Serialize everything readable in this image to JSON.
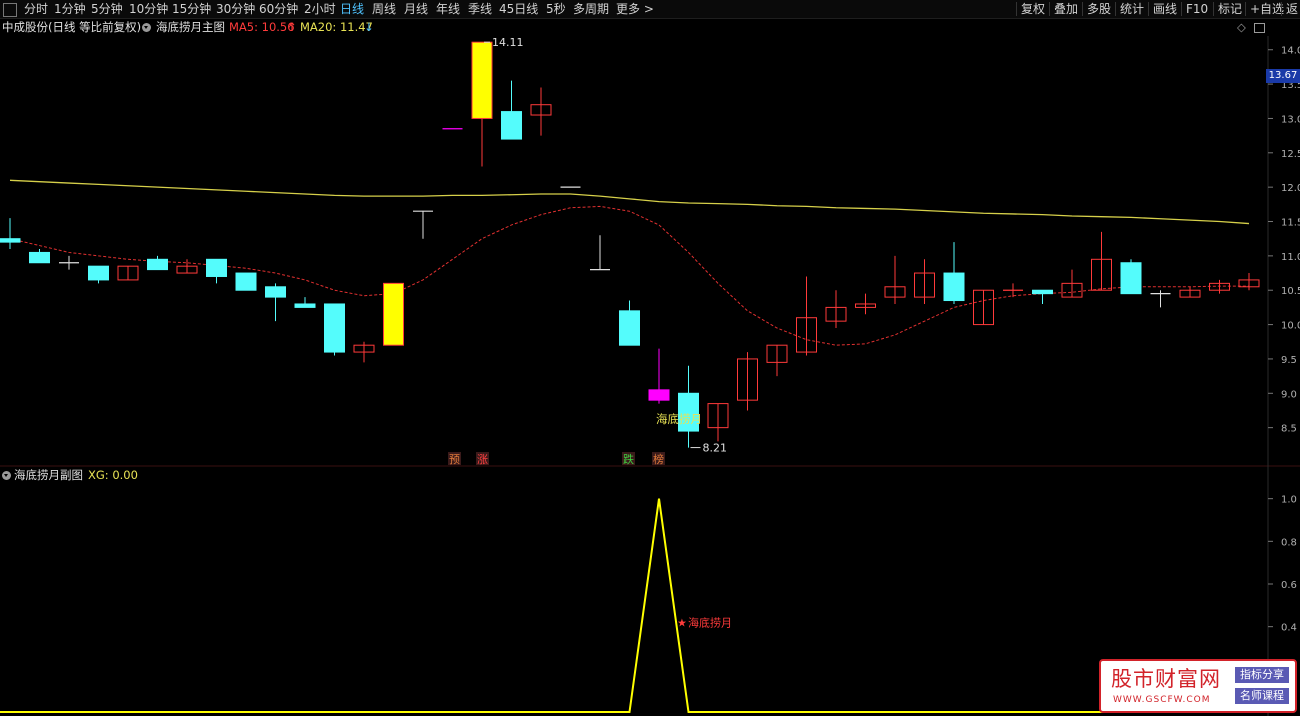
{
  "toolbar": {
    "periods": [
      "分时",
      "1分钟",
      "5分钟",
      "10分钟",
      "15分钟",
      "30分钟",
      "60分钟",
      "2小时",
      "日线",
      "周线",
      "月线",
      "年线",
      "季线",
      "45日线",
      "5秒",
      "多周期",
      "更多 >"
    ],
    "active_period": "日线",
    "right_buttons": [
      "复权",
      "叠加",
      "多股",
      "统计",
      "画线",
      "F10",
      "标记",
      "+自选",
      "返"
    ]
  },
  "main_chart": {
    "stock_title": "中成股份(日线 等比前复权)",
    "indicator_name": "海底捞月主图",
    "ma5_label": "MA5: 10.56",
    "ma5_arrow": "↑",
    "ma20_label": "MA20: 11.47",
    "ma20_arrow": "↓",
    "high_marker": "14.11",
    "low_marker": "8.21",
    "signal_text": "海底捞月",
    "signal_boxes": [
      "预",
      "涨",
      "跌",
      "榜"
    ],
    "current_price_tag": "13.67",
    "price_axis": [
      "14.0",
      "13.5",
      "13.0",
      "12.5",
      "12.0",
      "11.5",
      "11.0",
      "10.5",
      "10.0",
      "9.5",
      "9.0",
      "8.5"
    ],
    "colors": {
      "up": "#ff3a3a",
      "down": "#54fcfc",
      "ma5": "#e13030",
      "ma20": "#d6d04a",
      "yellow_signal": "#ffff00",
      "magenta": "#ff00ff"
    }
  },
  "sub_chart": {
    "indicator_name": "海底捞月副图",
    "xg_label": "XG: 0.00",
    "signal_label": "海底捞月",
    "axis": [
      "1.0",
      "0.8",
      "0.6",
      "0.4"
    ]
  },
  "chart_data": {
    "type": "candlestick",
    "title": "中成股份(日线 等比前复权)",
    "candles": [
      {
        "o": 11.25,
        "c": 11.2,
        "h": 11.55,
        "l": 11.1,
        "color": "down"
      },
      {
        "o": 11.05,
        "c": 10.9,
        "h": 11.1,
        "l": 10.9,
        "color": "down"
      },
      {
        "o": 10.9,
        "c": 10.9,
        "h": 11.0,
        "l": 10.8,
        "color": "flat"
      },
      {
        "o": 10.85,
        "c": 10.65,
        "h": 10.85,
        "l": 10.6,
        "color": "down"
      },
      {
        "o": 10.65,
        "c": 10.85,
        "h": 10.85,
        "l": 10.65,
        "color": "up"
      },
      {
        "o": 10.95,
        "c": 10.8,
        "h": 11.0,
        "l": 10.8,
        "color": "down"
      },
      {
        "o": 10.75,
        "c": 10.85,
        "h": 10.95,
        "l": 10.75,
        "color": "up"
      },
      {
        "o": 10.95,
        "c": 10.7,
        "h": 10.95,
        "l": 10.6,
        "color": "down"
      },
      {
        "o": 10.75,
        "c": 10.5,
        "h": 10.75,
        "l": 10.5,
        "color": "down"
      },
      {
        "o": 10.55,
        "c": 10.4,
        "h": 10.6,
        "l": 10.05,
        "color": "down"
      },
      {
        "o": 10.3,
        "c": 10.25,
        "h": 10.4,
        "l": 10.25,
        "color": "down"
      },
      {
        "o": 10.3,
        "c": 9.6,
        "h": 10.3,
        "l": 9.55,
        "color": "down"
      },
      {
        "o": 9.6,
        "c": 9.7,
        "h": 9.75,
        "l": 9.45,
        "color": "up"
      },
      {
        "o": 9.7,
        "c": 10.6,
        "h": 10.6,
        "l": 9.7,
        "color": "yellow"
      },
      {
        "o": 11.65,
        "c": 11.65,
        "h": 11.65,
        "l": 11.25,
        "color": "flat"
      },
      {
        "o": 12.85,
        "c": 12.85,
        "h": 12.85,
        "l": 12.85,
        "color": "magenta"
      },
      {
        "o": 13.0,
        "c": 14.11,
        "h": 14.11,
        "l": 12.3,
        "color": "yellow"
      },
      {
        "o": 13.1,
        "c": 12.7,
        "h": 13.55,
        "l": 12.7,
        "color": "down"
      },
      {
        "o": 13.05,
        "c": 13.2,
        "h": 13.45,
        "l": 12.75,
        "color": "up"
      },
      {
        "o": 12.0,
        "c": 12.0,
        "h": 12.0,
        "l": 12.0,
        "color": "flat"
      },
      {
        "o": 10.8,
        "c": 10.8,
        "h": 11.3,
        "l": 10.8,
        "color": "flat"
      },
      {
        "o": 10.2,
        "c": 9.7,
        "h": 10.35,
        "l": 9.7,
        "color": "down"
      },
      {
        "o": 8.9,
        "c": 9.05,
        "h": 9.65,
        "l": 8.85,
        "color": "magenta"
      },
      {
        "o": 9.0,
        "c": 8.45,
        "h": 9.4,
        "l": 8.21,
        "color": "down"
      },
      {
        "o": 8.5,
        "c": 8.85,
        "h": 8.85,
        "l": 8.3,
        "color": "up"
      },
      {
        "o": 8.9,
        "c": 9.5,
        "h": 9.6,
        "l": 8.75,
        "color": "up"
      },
      {
        "o": 9.45,
        "c": 9.7,
        "h": 9.7,
        "l": 9.25,
        "color": "up"
      },
      {
        "o": 9.6,
        "c": 10.1,
        "h": 10.7,
        "l": 9.55,
        "color": "up"
      },
      {
        "o": 10.05,
        "c": 10.25,
        "h": 10.5,
        "l": 9.95,
        "color": "up"
      },
      {
        "o": 10.25,
        "c": 10.3,
        "h": 10.45,
        "l": 10.15,
        "color": "up"
      },
      {
        "o": 10.4,
        "c": 10.55,
        "h": 11.0,
        "l": 10.3,
        "color": "up"
      },
      {
        "o": 10.4,
        "c": 10.75,
        "h": 10.95,
        "l": 10.3,
        "color": "up"
      },
      {
        "o": 10.75,
        "c": 10.35,
        "h": 11.2,
        "l": 10.3,
        "color": "down"
      },
      {
        "o": 10.0,
        "c": 10.5,
        "h": 10.5,
        "l": 10.0,
        "color": "up"
      },
      {
        "o": 10.5,
        "c": 10.5,
        "h": 10.6,
        "l": 10.4,
        "color": "up"
      },
      {
        "o": 10.5,
        "c": 10.45,
        "h": 10.5,
        "l": 10.3,
        "color": "down"
      },
      {
        "o": 10.4,
        "c": 10.6,
        "h": 10.8,
        "l": 10.4,
        "color": "up"
      },
      {
        "o": 10.5,
        "c": 10.95,
        "h": 11.35,
        "l": 10.5,
        "color": "up"
      },
      {
        "o": 10.9,
        "c": 10.45,
        "h": 10.95,
        "l": 10.45,
        "color": "down"
      },
      {
        "o": 10.45,
        "c": 10.45,
        "h": 10.5,
        "l": 10.25,
        "color": "flat"
      },
      {
        "o": 10.4,
        "c": 10.5,
        "h": 10.55,
        "l": 10.4,
        "color": "up"
      },
      {
        "o": 10.5,
        "c": 10.6,
        "h": 10.65,
        "l": 10.45,
        "color": "up"
      },
      {
        "o": 10.55,
        "c": 10.65,
        "h": 10.75,
        "l": 10.5,
        "color": "up"
      }
    ],
    "ma20": [
      12.1,
      12.08,
      12.06,
      12.04,
      12.02,
      12.0,
      11.98,
      11.96,
      11.94,
      11.92,
      11.9,
      11.88,
      11.87,
      11.87,
      11.87,
      11.88,
      11.88,
      11.89,
      11.9,
      11.9,
      11.87,
      11.83,
      11.79,
      11.77,
      11.76,
      11.75,
      11.73,
      11.72,
      11.7,
      11.69,
      11.68,
      11.66,
      11.64,
      11.62,
      11.61,
      11.6,
      11.58,
      11.57,
      11.56,
      11.54,
      11.52,
      11.5,
      11.47
    ],
    "ma5": [
      11.25,
      11.15,
      11.05,
      11.0,
      10.95,
      10.92,
      10.9,
      10.86,
      10.82,
      10.75,
      10.65,
      10.5,
      10.42,
      10.45,
      10.65,
      10.95,
      11.25,
      11.45,
      11.6,
      11.7,
      11.72,
      11.65,
      11.45,
      11.05,
      10.6,
      10.2,
      9.95,
      9.78,
      9.7,
      9.72,
      9.85,
      10.05,
      10.25,
      10.35,
      10.42,
      10.45,
      10.47,
      10.52,
      10.55,
      10.55,
      10.55,
      10.56,
      10.56
    ],
    "sub_series": [
      0,
      0,
      0,
      0,
      0,
      0,
      0,
      0,
      0,
      0,
      0,
      0,
      0,
      0,
      0,
      0,
      0,
      0,
      0,
      0,
      0,
      0,
      1,
      0,
      0,
      0,
      0,
      0,
      0,
      0,
      0,
      0,
      0,
      0,
      0,
      0,
      0,
      0,
      0,
      0,
      0,
      0,
      0
    ],
    "ylim_main": [
      8.0,
      14.2
    ],
    "ylim_sub": [
      0,
      1.05
    ]
  },
  "watermark": {
    "site": "股市财富网",
    "url": "WWW.GSCFW.COM",
    "tag1": "指标分享",
    "tag2": "名师课程"
  }
}
